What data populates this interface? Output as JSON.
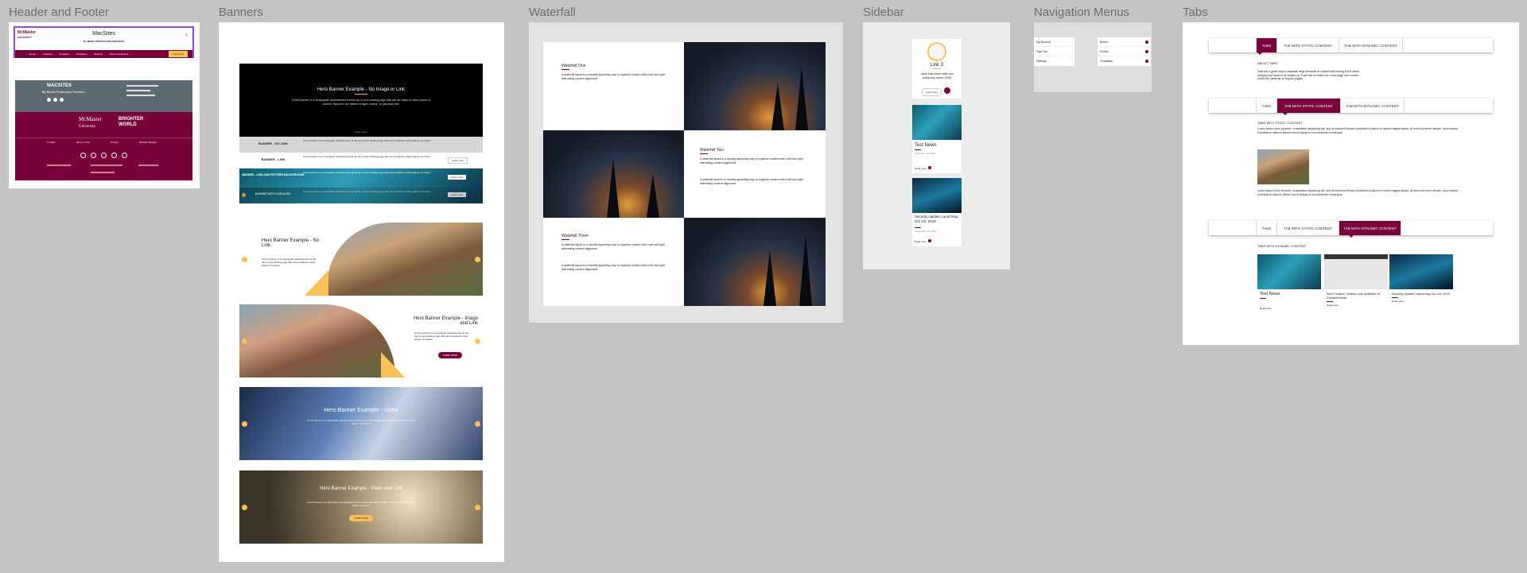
{
  "sections": {
    "header_footer": "Header and Footer",
    "banners": "Banners",
    "waterfall": "Waterfall",
    "sidebar": "Sidebar",
    "nav_menus": "Navigation Menus",
    "tabs": "Tabs"
  },
  "header": {
    "logo_line1": "McMaster",
    "logo_line2": "UNIVERSITY",
    "site_title": "MacSites",
    "site_subtitle": "BY MEDIA PRODUCTION SERVICES",
    "nav": [
      "Home",
      "Features",
      "Contacts",
      "Templates",
      "Support",
      "News and Events"
    ],
    "nav_button": "Contact us"
  },
  "footer": {
    "site_title": "MACSITES",
    "site_subtitle": "By Media Production Services",
    "brand_line1": "BRIGHTER",
    "brand_line2": "WORLD",
    "logo_line1": "McMaster",
    "logo_line2": "University",
    "links": [
      "Contact",
      "Terms of Use",
      "Privacy",
      "Website Support"
    ]
  },
  "banners": {
    "b1_title": "Hero Banner Example - No Image or Link",
    "b1_body": "A hero banner is a rectangular advertisement at the top of your landing page that can be linked to other places of content. Banners can feature images, videos, or just plain text.",
    "b1_more": "Learn more",
    "row1_label": "BANNER - NO LINK",
    "row2_label": "BANNER - LINK",
    "row3_label": "BANNER - LINK AND PATTERN BACKGROUND",
    "row4_label": "BANNER WITH CAROUSEL",
    "row_body": "A hero banner is a rectangular advertisement at the top of your landing page that can be linked to other places of content.",
    "row_button": "Learn more",
    "b2_title": "Hero Banner Example - No Link",
    "b3_title": "Hero Banner Example - Image and Link",
    "b3_button": "Learn more",
    "b4_title": "Hero Banner Example - Video",
    "b5_title": "Hero Banner Example - Video and Link",
    "b5_button": "Learn more"
  },
  "waterfall": {
    "w1_title": "Waterfall One",
    "w2_title": "Waterfall Two",
    "w3_title": "Waterfall Three",
    "body": "A waterfall layout is a visually appealing way to organize content with a left and right alternating content alignment."
  },
  "sidebar": {
    "profile_title": "Link 3",
    "profile_body": "Jane has been with our company since 2005",
    "profile_button": "Learn more",
    "card1_title": "Test News",
    "card1_date": "November 10, 2021",
    "card1_link": "Read more",
    "card2_title": "Security Update Launching Oct 1st, 2019",
    "card2_date": "September 30, 2019",
    "card2_link": "Read more"
  },
  "nav_menus": {
    "left": [
      "My Account",
      "Sign Out",
      "Settings"
    ],
    "right": [
      "Button",
      "Events",
      "Templates"
    ]
  },
  "tabs": {
    "tabs1": [
      "TABS",
      "TAB WITH STATIC CONTENT",
      "TAB WITH DYNAMIC CONTENT"
    ],
    "about_heading": "ABOUT TABS",
    "about_body": "Tabs are a great way to separate large amounts of content that belong in the same category but need to be broken up. Each tab is treated as a new page and content works the same as on regular pages.",
    "static_heading": "TABS WITH STATIC CONTENT",
    "lorem": "Lorem ipsum dolor sit amet, consectetur adipiscing elit, sed do eiusmod tempor incididunt ut labore et dolore magna aliqua. Ut enim ad minim veniam, quis nostrud exercitation ullamco laboris nisi ut aliquip ex ea commodo consequat.",
    "dynamic_heading": "TABS WITH DYNAMIC CONTENT",
    "card1_title": "Test News",
    "card2_title": "New Feature: Videos now available in Content Areas",
    "card3_title": "Security Update Launching Oct 1st, 2019",
    "read_more": "Read more"
  },
  "colors": {
    "maroon": "#7a003c",
    "gold": "#fdbf57",
    "grey": "#5e6a71"
  }
}
